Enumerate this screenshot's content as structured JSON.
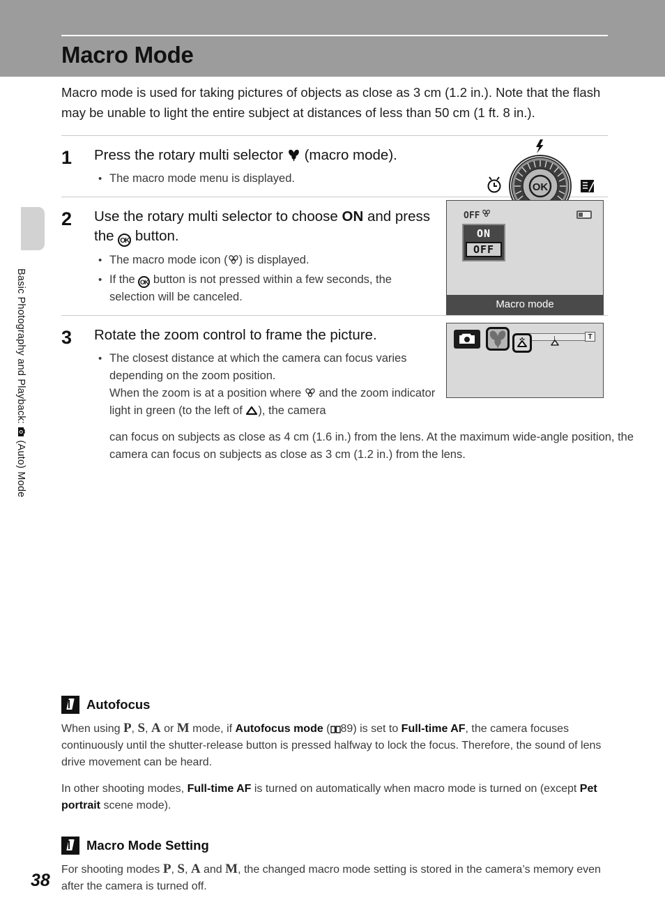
{
  "header": {
    "title": "Macro Mode"
  },
  "sidebar": {
    "chapter_label_part1": "Basic Photography and Playback:",
    "camera_icon": "camera-auto-icon",
    "chapter_label_part2": "(Auto) Mode",
    "page_number": "38"
  },
  "intro": "Macro mode is used for taking pictures of objects as close as 3 cm (1.2 in.). Note that the flash may be unable to light the entire subject at distances of less than 50 cm (1 ft. 8 in.).",
  "steps": [
    {
      "number": "1",
      "heading_pre": "Press the rotary multi selector",
      "heading_icon": "macro-flower-icon",
      "heading_post": "(macro mode).",
      "bullets": [
        "The macro mode menu is displayed."
      ],
      "illustration": {
        "type": "rotary-multi-selector",
        "center_label": "OK",
        "top_icon": "flash-icon",
        "left_icon": "self-timer-icon",
        "right_icon": "exposure-compensation-icon",
        "bottom_icon": "macro-flower-icon"
      }
    },
    {
      "number": "2",
      "heading_pre": "Use the rotary multi selector to choose",
      "heading_bold": "ON",
      "heading_mid": "and press the",
      "heading_icon": "ok-button-icon",
      "heading_post": "button.",
      "bullets": [
        "The macro mode icon (❀) is displayed.",
        "If the OK button is not pressed within a few seconds, the selection will be canceled."
      ],
      "illustration": {
        "type": "lcd-menu",
        "status_icon": "macro-off-icon",
        "battery_icon": "battery-icon",
        "options": [
          "ON",
          "OFF"
        ],
        "selected_option": "OFF",
        "caption": "Macro mode"
      }
    },
    {
      "number": "3",
      "heading_pre": "Rotate the zoom control to frame the picture.",
      "bullets_rich": {
        "line1": "The closest distance at which the camera can focus varies depending on the zoom position.",
        "line2_pre": "When the zoom is at a position where",
        "line2_icon": "macro-flower-icon",
        "line2_mid": "and the zoom indicator light in green (to the left of",
        "line2_icon2": "mountain-icon",
        "line2_post": "), the camera"
      },
      "wide_note": "can focus on subjects as close as 4 cm (1.6 in.) from the lens. At the maximum wide-angle position, the camera can focus on subjects as close as 3 cm (1.2 in.) from the lens.",
      "illustration": {
        "type": "lcd-zoom-indicator",
        "mode_icon": "camera-auto-icon",
        "macro_icon": "macro-flower-icon",
        "af_icon": "autofocus-mountain-icon",
        "zoom_tele_label": "T",
        "zoom_wide_mark": "mountain-icon"
      }
    }
  ],
  "notes": [
    {
      "badge": "pencil-icon",
      "title": "Autofocus",
      "paragraphs": [
        {
          "segments": [
            {
              "t": "When using ",
              "b": false
            },
            {
              "t": "P",
              "b": false,
              "mode": true
            },
            {
              "t": ", ",
              "b": false
            },
            {
              "t": "S",
              "b": false,
              "mode": true
            },
            {
              "t": ", ",
              "b": false
            },
            {
              "t": "A",
              "b": false,
              "mode": true
            },
            {
              "t": " or ",
              "b": false
            },
            {
              "t": "M",
              "b": false,
              "mode": true
            },
            {
              "t": " mode, if ",
              "b": false
            },
            {
              "t": "Autofocus mode",
              "b": true
            },
            {
              "t": " (",
              "b": false
            },
            {
              "t": "⌧",
              "b": false,
              "book": true
            },
            {
              "t": "89) is set to ",
              "b": false
            },
            {
              "t": "Full-time AF",
              "b": true
            },
            {
              "t": ", the camera focuses continuously until the shutter-release button is pressed halfway to lock the focus. Therefore, the sound of lens drive movement can be heard.",
              "b": false
            }
          ]
        },
        {
          "segments": [
            {
              "t": "In other shooting modes, ",
              "b": false
            },
            {
              "t": "Full-time AF",
              "b": true
            },
            {
              "t": " is turned on automatically when macro mode is turned on (except ",
              "b": false
            },
            {
              "t": "Pet portrait",
              "b": true
            },
            {
              "t": " scene mode).",
              "b": false
            }
          ]
        }
      ]
    },
    {
      "badge": "pencil-icon",
      "title": "Macro Mode Setting",
      "paragraphs": [
        {
          "segments": [
            {
              "t": "For shooting modes ",
              "b": false
            },
            {
              "t": "P",
              "b": false,
              "mode": true
            },
            {
              "t": ", ",
              "b": false
            },
            {
              "t": "S",
              "b": false,
              "mode": true
            },
            {
              "t": ", ",
              "b": false
            },
            {
              "t": "A",
              "b": false,
              "mode": true
            },
            {
              "t": " and ",
              "b": false
            },
            {
              "t": "M",
              "b": false,
              "mode": true
            },
            {
              "t": ", the changed macro mode setting is stored in the camera’s memory even after the camera is turned off.",
              "b": false
            }
          ]
        }
      ]
    }
  ],
  "colors": {
    "header_band": "#9c9c9c",
    "lcd_background": "#d9d9d9",
    "lcd_caption_bar": "#4a4a4a",
    "side_tab": "#d2d2d2"
  }
}
